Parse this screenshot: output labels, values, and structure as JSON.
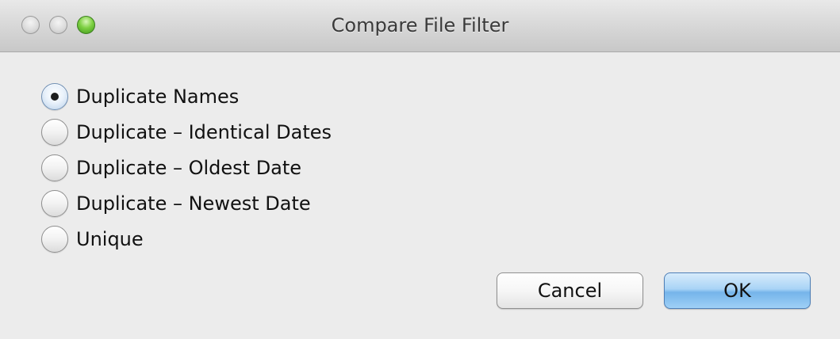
{
  "window": {
    "title": "Compare File Filter",
    "traffic_lights": {
      "close": "close-icon",
      "minimize": "minimize-icon",
      "zoom": "zoom-icon"
    }
  },
  "filter_options": [
    {
      "label": "Duplicate Names",
      "selected": true
    },
    {
      "label": "Duplicate – Identical Dates",
      "selected": false
    },
    {
      "label": "Duplicate – Oldest Date",
      "selected": false
    },
    {
      "label": "Duplicate – Newest Date",
      "selected": false
    },
    {
      "label": "Unique",
      "selected": false
    }
  ],
  "buttons": {
    "cancel_label": "Cancel",
    "ok_label": "OK"
  },
  "colors": {
    "window_bg": "#ececec",
    "default_button_accent": "#75b4ea",
    "zoom_button": "#7ed043"
  }
}
